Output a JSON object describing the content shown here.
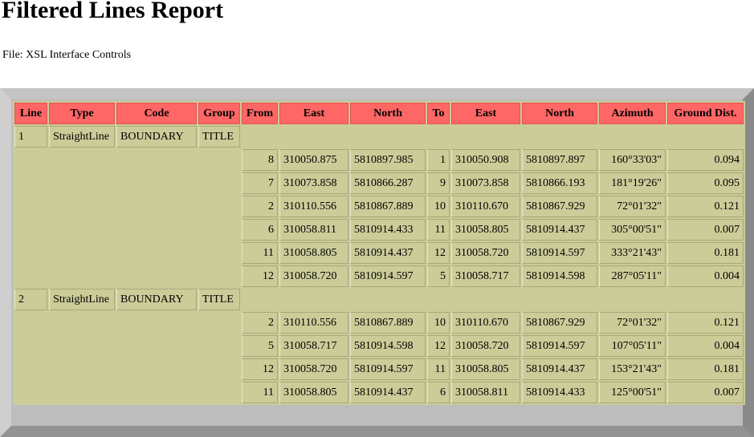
{
  "title": "Filtered Lines Report",
  "file_line": "File: XSL Interface Controls",
  "colors": {
    "header_bg": "#ff6666",
    "cell_bg": "#cccc99",
    "frame": "#bdbdbd"
  },
  "columns": [
    "Line",
    "Type",
    "Code",
    "Group",
    "From",
    "East",
    "North",
    "To",
    "East",
    "North",
    "Azimuth",
    "Ground Dist."
  ],
  "lines": [
    {
      "line": "1",
      "type": "StraightLine",
      "code": "BOUNDARY",
      "group": "TITLE",
      "segments": [
        {
          "from": "8",
          "east1": "310050.875",
          "north1": "5810897.985",
          "to": "1",
          "east2": "310050.908",
          "north2": "5810897.897",
          "azimuth": "160°33'03\"",
          "dist": "0.094"
        },
        {
          "from": "7",
          "east1": "310073.858",
          "north1": "5810866.287",
          "to": "9",
          "east2": "310073.858",
          "north2": "5810866.193",
          "azimuth": "181°19'26\"",
          "dist": "0.095"
        },
        {
          "from": "2",
          "east1": "310110.556",
          "north1": "5810867.889",
          "to": "10",
          "east2": "310110.670",
          "north2": "5810867.929",
          "azimuth": "72°01'32\"",
          "dist": "0.121"
        },
        {
          "from": "6",
          "east1": "310058.811",
          "north1": "5810914.433",
          "to": "11",
          "east2": "310058.805",
          "north2": "5810914.437",
          "azimuth": "305°00'51\"",
          "dist": "0.007"
        },
        {
          "from": "11",
          "east1": "310058.805",
          "north1": "5810914.437",
          "to": "12",
          "east2": "310058.720",
          "north2": "5810914.597",
          "azimuth": "333°21'43\"",
          "dist": "0.181"
        },
        {
          "from": "12",
          "east1": "310058.720",
          "north1": "5810914.597",
          "to": "5",
          "east2": "310058.717",
          "north2": "5810914.598",
          "azimuth": "287°05'11\"",
          "dist": "0.004"
        }
      ]
    },
    {
      "line": "2",
      "type": "StraightLine",
      "code": "BOUNDARY",
      "group": "TITLE",
      "segments": [
        {
          "from": "2",
          "east1": "310110.556",
          "north1": "5810867.889",
          "to": "10",
          "east2": "310110.670",
          "north2": "5810867.929",
          "azimuth": "72°01'32\"",
          "dist": "0.121"
        },
        {
          "from": "5",
          "east1": "310058.717",
          "north1": "5810914.598",
          "to": "12",
          "east2": "310058.720",
          "north2": "5810914.597",
          "azimuth": "107°05'11\"",
          "dist": "0.004"
        },
        {
          "from": "12",
          "east1": "310058.720",
          "north1": "5810914.597",
          "to": "11",
          "east2": "310058.805",
          "north2": "5810914.437",
          "azimuth": "153°21'43\"",
          "dist": "0.181"
        },
        {
          "from": "11",
          "east1": "310058.805",
          "north1": "5810914.437",
          "to": "6",
          "east2": "310058.811",
          "north2": "5810914.433",
          "azimuth": "125°00'51\"",
          "dist": "0.007"
        }
      ]
    }
  ]
}
